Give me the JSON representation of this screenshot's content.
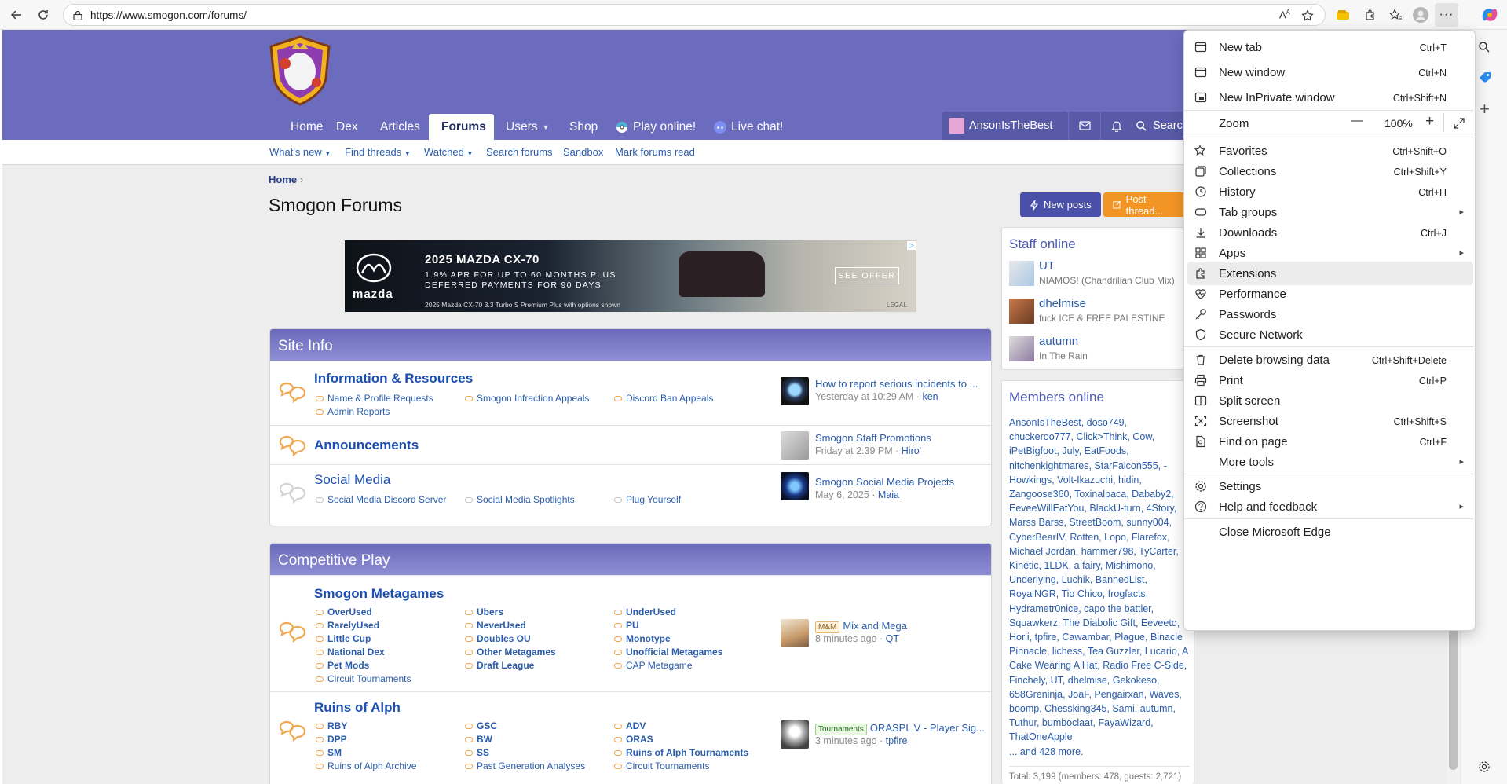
{
  "browser": {
    "url": "https://www.smogon.com/forums/"
  },
  "nav": {
    "items": [
      "Home",
      "Dex",
      "Articles",
      "Forums",
      "Users",
      "Shop",
      "Play online!",
      "Live chat!"
    ],
    "user": "AnsonIsTheBest",
    "search": "Searc"
  },
  "subnav": [
    "What's new",
    "Find threads",
    "Watched",
    "Search forums",
    "Sandbox",
    "Mark forums read"
  ],
  "page": {
    "breadcrumb": "Home",
    "title": "Smogon Forums",
    "new_posts": "New posts",
    "post_thread": "Post thread..."
  },
  "ad": {
    "headline": "2025 MAZDA CX-70",
    "line1": "1.9% APR FOR UP TO 60 MONTHS PLUS",
    "line2": "DEFERRED PAYMENTS FOR 90 DAYS",
    "fine": "2025 Mazda CX-70 3.3 Turbo S Premium Plus with options shown",
    "cta": "SEE OFFER",
    "brand": "mazda",
    "legal": "LEGAL"
  },
  "site_info": {
    "title": "Site Info",
    "nodes": [
      {
        "title": "Information & Resources",
        "subs": [
          "Name & Profile Requests",
          "Smogon Infraction Appeals",
          "Discord Ban Appeals",
          "Admin Reports"
        ],
        "latest": "How to report serious incidents to ...",
        "meta": "Yesterday at 10:29 AM · ",
        "user": "ken"
      },
      {
        "title": "Announcements",
        "subs": [],
        "latest": "Smogon Staff Promotions",
        "meta": "Friday at 2:39 PM · ",
        "user": "Hiro'"
      },
      {
        "title": "Social Media",
        "subs": [
          "Social Media Discord Server",
          "Social Media Spotlights",
          "Plug Yourself"
        ],
        "latest": "Smogon Social Media Projects",
        "meta": "May 6, 2025 · ",
        "user": "Maia"
      }
    ]
  },
  "competitive": {
    "title": "Competitive Play",
    "nodes": [
      {
        "title": "Smogon Metagames",
        "subs": [
          "OverUsed",
          "Ubers",
          "UnderUsed",
          "RarelyUsed",
          "NeverUsed",
          "PU",
          "Little Cup",
          "Doubles OU",
          "Monotype",
          "National Dex",
          "Other Metagames",
          "Unofficial Metagames",
          "Pet Mods",
          "Draft League",
          "CAP Metagame",
          "Circuit Tournaments"
        ],
        "tag": "M&M",
        "latest": "Mix and Mega",
        "meta": "8 minutes ago · ",
        "user": "QT"
      },
      {
        "title": "Ruins of Alph",
        "subs": [
          "RBY",
          "GSC",
          "ADV",
          "DPP",
          "BW",
          "ORAS",
          "SM",
          "SS",
          "Ruins of Alph Tournaments",
          "Ruins of Alph Archive",
          "Past Generation Analyses",
          "Circuit Tournaments"
        ],
        "tag": "Tournaments",
        "latest": "ORASPL V - Player Sig...",
        "meta": "3 minutes ago · ",
        "user": "tpfire"
      }
    ]
  },
  "staff_online": {
    "title": "Staff online",
    "members": [
      {
        "name": "UT",
        "status": "NIAMOS! (Chandrilian Club Mix)"
      },
      {
        "name": "dhelmise",
        "status": "fuck ICE & FREE PALESTINE"
      },
      {
        "name": "autumn",
        "status": "In The Rain"
      }
    ]
  },
  "members_online": {
    "title": "Members online",
    "list": "AnsonIsTheBest, doso749, chuckeroo777, Click>Think, Cow, iPetBigfoot, July, EatFoods, nitchenkightmares, StarFalcon555, -Howkings, Volt-Ikazuchi, hidin, Zangoose360, Toxinalpaca, Dababy2, EeveeWillEatYou, BlackU-turn, 4Story, Marss Barss, StreetBoom, sunny004, CyberBearIV, Rotten, Lopo, Flarefox, Michael Jordan, hammer798, TyCarter, Kinetic, 1LDK, a fairy, Mishimono, Underlying, Luchik, BannedList, RoyalNGR, Tio Chico, frogfacts, Hydrametr0nice, capo the battler, Squawkerz, The Diabolic Gift, Eeveeto, Horii, tpfire, Cawambar, Plague, Binacle Pinnacle, lichess, Tea Guzzler, Lucario, A Cake Wearing A Hat, Radio Free C-Side, Finchely, UT, dhelmise, Gekokeso, 658Greninja, JoaF, Pengairxan, Waves, boomp, Chessking345, Sami, autumn, Tuthur, bumboclaat, FayaWizard, ThatOneApple",
    "more": "... and 428 more.",
    "total": "Total: 3,199 (members: 478, guests: 2,721)"
  },
  "edge_menu": {
    "items": [
      {
        "label": "New tab",
        "shortcut": "Ctrl+T",
        "icon": "new-tab-icon"
      },
      {
        "label": "New window",
        "shortcut": "Ctrl+N",
        "icon": "window-icon"
      },
      {
        "label": "New InPrivate window",
        "shortcut": "Ctrl+Shift+N",
        "icon": "inprivate-icon"
      },
      {
        "label": "Zoom",
        "zoom_value": "100%",
        "zoom_minus": "—",
        "zoom_plus": "+"
      },
      {
        "label": "Favorites",
        "shortcut": "Ctrl+Shift+O",
        "icon": "star-icon"
      },
      {
        "label": "Collections",
        "shortcut": "Ctrl+Shift+Y",
        "icon": "collections-icon"
      },
      {
        "label": "History",
        "shortcut": "Ctrl+H",
        "icon": "history-icon"
      },
      {
        "label": "Tab groups",
        "submenu": true,
        "icon": "tab-groups-icon"
      },
      {
        "label": "Downloads",
        "shortcut": "Ctrl+J",
        "icon": "download-icon"
      },
      {
        "label": "Apps",
        "submenu": true,
        "icon": "apps-icon"
      },
      {
        "label": "Extensions",
        "highlighted": true,
        "icon": "extensions-icon"
      },
      {
        "label": "Performance",
        "icon": "performance-icon"
      },
      {
        "label": "Passwords",
        "icon": "key-icon"
      },
      {
        "label": "Secure Network",
        "icon": "shield-icon"
      },
      {
        "label": "Delete browsing data",
        "shortcut": "Ctrl+Shift+Delete",
        "icon": "trash-icon"
      },
      {
        "label": "Print",
        "shortcut": "Ctrl+P",
        "icon": "print-icon"
      },
      {
        "label": "Split screen",
        "icon": "split-screen-icon"
      },
      {
        "label": "Screenshot",
        "shortcut": "Ctrl+Shift+S",
        "icon": "screenshot-icon"
      },
      {
        "label": "Find on page",
        "shortcut": "Ctrl+F",
        "icon": "find-icon"
      },
      {
        "label": "More tools",
        "submenu": true
      },
      {
        "label": "Settings",
        "icon": "gear-icon"
      },
      {
        "label": "Help and feedback",
        "submenu": true,
        "icon": "help-icon"
      },
      {
        "label": "Close Microsoft Edge"
      }
    ]
  },
  "colors": {
    "brand": "#6c6cbf",
    "new_posts": "#4a4fa8",
    "post_thread": "#f29524",
    "link": "#2a5caa"
  }
}
